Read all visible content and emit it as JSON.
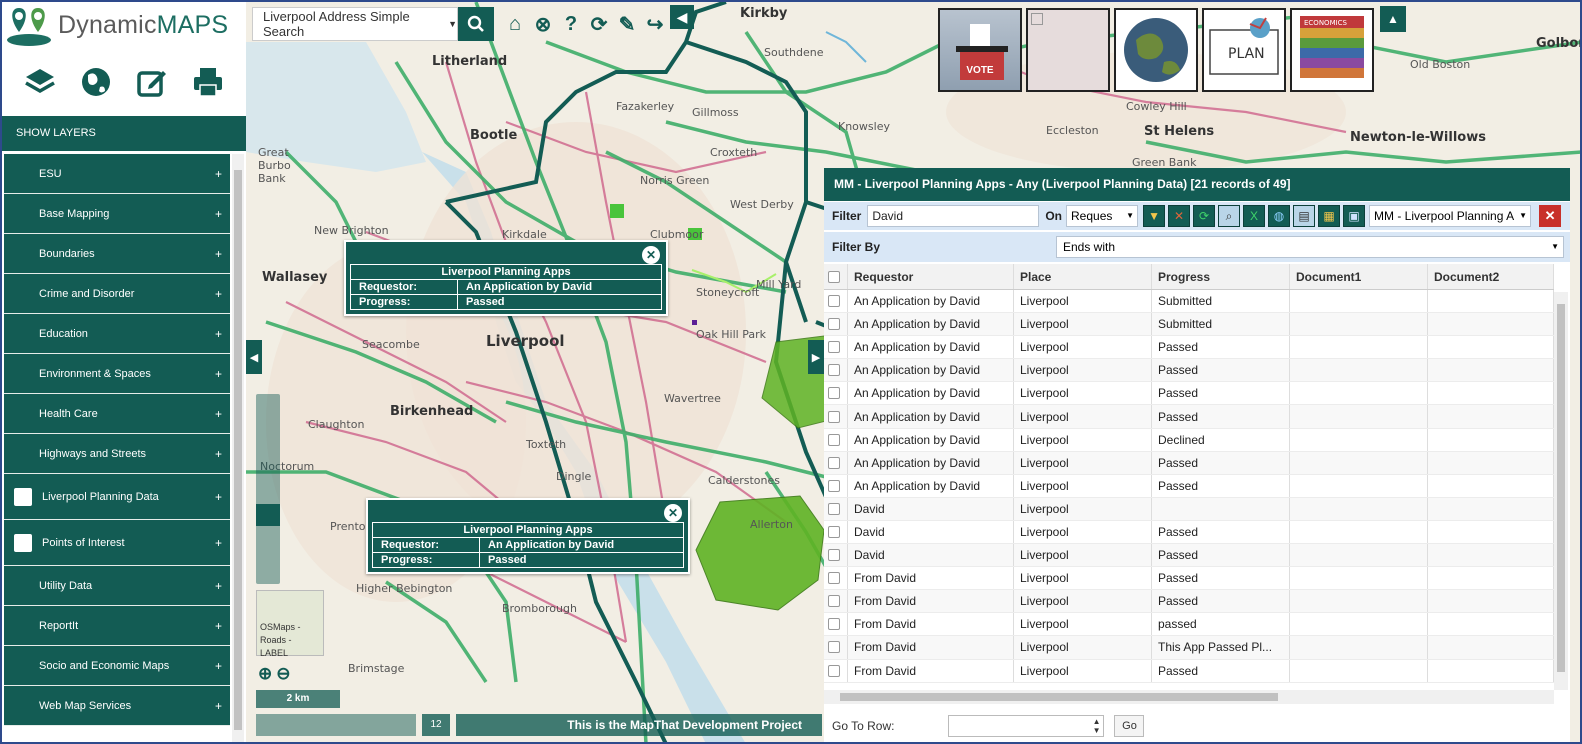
{
  "app": {
    "logo_part1": "Dynamic",
    "logo_part2": "MAPS"
  },
  "search": {
    "label": "Liverpool Address Simple Search"
  },
  "sidebar": {
    "show_layers": "SHOW LAYERS",
    "items": [
      {
        "label": "ESU",
        "checkbox": false
      },
      {
        "label": "Base Mapping",
        "checkbox": false
      },
      {
        "label": "Boundaries",
        "checkbox": false
      },
      {
        "label": "Crime and Disorder",
        "checkbox": false
      },
      {
        "label": "Education",
        "checkbox": false
      },
      {
        "label": "Environment & Spaces",
        "checkbox": false
      },
      {
        "label": "Health Care",
        "checkbox": false
      },
      {
        "label": "Highways and Streets",
        "checkbox": false
      },
      {
        "label": "Liverpool Planning Data",
        "checkbox": true
      },
      {
        "label": "Points of Interest",
        "checkbox": true
      },
      {
        "label": "Utility Data",
        "checkbox": false
      },
      {
        "label": "ReportIt",
        "checkbox": false
      },
      {
        "label": "Socio and Economic Maps",
        "checkbox": false
      },
      {
        "label": "Web Map Services",
        "checkbox": false
      }
    ]
  },
  "map": {
    "places": [
      {
        "name": "Kirkby"
      },
      {
        "name": "Litherland"
      },
      {
        "name": "Southdene"
      },
      {
        "name": "Bootle"
      },
      {
        "name": "Wallasey"
      },
      {
        "name": "Liverpool"
      },
      {
        "name": "Birkenhead"
      },
      {
        "name": "Knowsley"
      },
      {
        "name": "St Helens"
      },
      {
        "name": "Newton-le-Willows"
      },
      {
        "name": "Eccleston"
      },
      {
        "name": "West Derby"
      },
      {
        "name": "Norris Green"
      },
      {
        "name": "Croxteth"
      },
      {
        "name": "Stoneycroft"
      },
      {
        "name": "Wavertree"
      },
      {
        "name": "Toxteth"
      },
      {
        "name": "Dingle"
      },
      {
        "name": "Calderstones"
      },
      {
        "name": "Allerton"
      },
      {
        "name": "Prenton"
      },
      {
        "name": "Claughton"
      },
      {
        "name": "Seacombe"
      },
      {
        "name": "Higher Bebington"
      },
      {
        "name": "Bromborough"
      },
      {
        "name": "Brimstage"
      },
      {
        "name": "New Brighton"
      },
      {
        "name": "Great Burbo Bank"
      },
      {
        "name": "Fazakerley"
      },
      {
        "name": "Gillmoss"
      },
      {
        "name": "Cowley Hill"
      },
      {
        "name": "Green Bank"
      },
      {
        "name": "Old Boston"
      },
      {
        "name": "Golborne"
      },
      {
        "name": "Kirkdale"
      },
      {
        "name": "Clubmoor"
      },
      {
        "name": "Oak Hill Park"
      },
      {
        "name": "Mill Yard"
      },
      {
        "name": "Noctorum"
      }
    ],
    "popup1": {
      "title": "Liverpool Planning Apps",
      "k1": "Requestor:",
      "v1": "An Application by David",
      "k2": "Progress:",
      "v2": "Passed"
    },
    "popup2": {
      "title": "Liverpool Planning Apps",
      "k1": "Requestor:",
      "v1": "An Application by David",
      "k2": "Progress:",
      "v2": "Passed"
    },
    "basemap": {
      "label": "OSMaps - Roads - LABEL"
    },
    "scale": "2 km",
    "footer_page": "12",
    "footer_text": "This is the MapThat Development Project"
  },
  "thumbnails": [
    {
      "name": "vote",
      "label": "VOTE"
    },
    {
      "name": "blank",
      "label": ""
    },
    {
      "name": "globe",
      "label": ""
    },
    {
      "name": "plan",
      "label": "PLAN"
    },
    {
      "name": "economics",
      "label": "ECONOMICS"
    }
  ],
  "panel": {
    "title": "MM - Liverpool Planning Apps - Any (Liverpool Planning Data) [21 records of 49]",
    "filter_label": "Filter",
    "filter_value": "David",
    "on_label": "On",
    "on_value": "Reques",
    "layer_value": "MM - Liverpool Planning A",
    "filterby_label": "Filter By",
    "filterby_value": "Ends with",
    "columns": [
      "Requestor",
      "Place",
      "Progress",
      "Document1",
      "Document2"
    ],
    "rows": [
      [
        "An Application by David",
        "Liverpool",
        "Submitted"
      ],
      [
        "An Application by David",
        "Liverpool",
        "Submitted"
      ],
      [
        "An Application by David",
        "Liverpool",
        "Passed"
      ],
      [
        "An Application by David",
        "Liverpool",
        "Passed"
      ],
      [
        "An Application by David",
        "Liverpool",
        "Passed"
      ],
      [
        "An Application by David",
        "Liverpool",
        "Passed"
      ],
      [
        "An Application by David",
        "Liverpool",
        "Declined"
      ],
      [
        "An Application by David",
        "Liverpool",
        "Passed"
      ],
      [
        "An Application by David",
        "Liverpool",
        "Passed"
      ],
      [
        "David",
        "Liverpool",
        ""
      ],
      [
        "David",
        "Liverpool",
        "Passed"
      ],
      [
        "David",
        "Liverpool",
        "Passed"
      ],
      [
        "From David",
        "Liverpool",
        "Passed"
      ],
      [
        "From David",
        "Liverpool",
        "Passed"
      ],
      [
        "From David",
        "Liverpool",
        "passed"
      ],
      [
        "From David",
        "Liverpool",
        "This App Passed Pl..."
      ],
      [
        "From David",
        "Liverpool",
        "Passed"
      ]
    ],
    "goto_label": "Go To Row:",
    "go_button": "Go"
  },
  "colors": {
    "accent": "#135c54",
    "road": "#3fae6a",
    "major": "#c6336a"
  }
}
